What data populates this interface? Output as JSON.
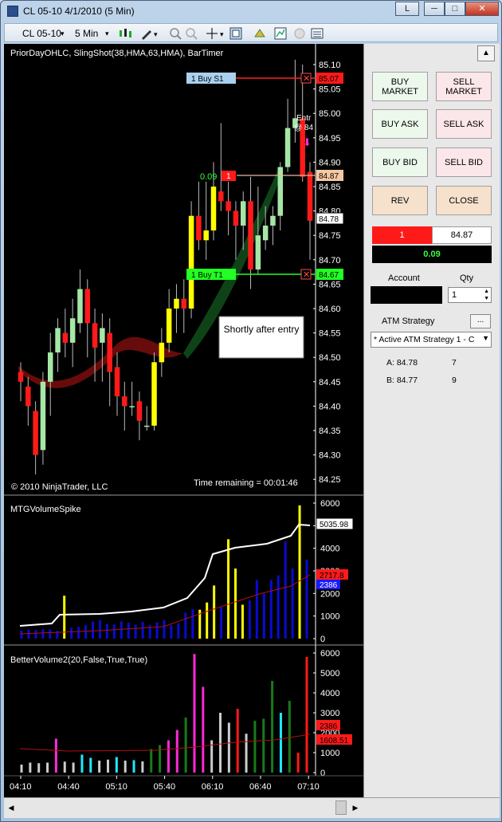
{
  "window": {
    "title": "CL 05-10  4/1/2010 (5 Min)",
    "link_btn": "L"
  },
  "toolbar": {
    "instrument": "CL 05-10",
    "interval": "5 Min"
  },
  "chart": {
    "indicator_label": "PriorDayOHLC, SlingShot(38,HMA,63,HMA), BarTimer",
    "copyright": "© 2010 NinjaTrader, LLC",
    "time_remaining": "Time remaining = 00:01:46",
    "annotation": "Shortly after entry",
    "entry_text": "Entr",
    "entry_text2": "@ 84",
    "orders": {
      "stop_label": "1  Buy S1",
      "stop_price": "85.07",
      "entry_qty": "1",
      "entry_pnl": "0.09",
      "entry_price": "84.87",
      "last_price": "84.78",
      "target_label": "1  Buy T1",
      "target_price": "84.67"
    },
    "price_ticks": [
      "85.10",
      "85.05",
      "85.00",
      "84.95",
      "84.90",
      "84.85",
      "84.80",
      "84.75",
      "84.70",
      "84.65",
      "84.60",
      "84.55",
      "84.50",
      "84.45",
      "84.40",
      "84.35",
      "84.30",
      "84.25"
    ],
    "vol_label": "MTGVolumeSpike",
    "vol_ticks": [
      "6000",
      "5000",
      "4000",
      "3000",
      "2000",
      "1000",
      "0"
    ],
    "vol_values": {
      "a": "5035.98",
      "b": "2717.8",
      "c": "2386"
    },
    "bv_label": "BetterVolume2(20,False,True,True)",
    "bv_ticks": [
      "6000",
      "5000",
      "4000",
      "3000",
      "2000",
      "1000",
      "0"
    ],
    "bv_values": {
      "a": "2386",
      "b": "1608.51"
    },
    "time_ticks": [
      "04:10",
      "04:40",
      "05:10",
      "05:40",
      "06:10",
      "06:40",
      "07:10"
    ]
  },
  "chart_data": {
    "type": "candlestick",
    "title": "CL 05-10 4/1/2010 (5 Min)",
    "x": [
      "04:10",
      "04:40",
      "05:10",
      "05:40",
      "06:10",
      "06:40",
      "07:10"
    ],
    "price_range": [
      84.25,
      85.12
    ],
    "candles": [
      [
        84.47,
        84.45,
        84.49,
        84.41
      ],
      [
        84.44,
        84.4,
        84.46,
        84.36
      ],
      [
        84.39,
        84.3,
        84.41,
        84.26
      ],
      [
        84.31,
        84.45,
        84.47,
        84.28
      ],
      [
        84.45,
        84.51,
        84.55,
        84.38
      ],
      [
        84.51,
        84.56,
        84.58,
        84.47
      ],
      [
        84.55,
        84.53,
        84.6,
        84.5
      ],
      [
        84.53,
        84.58,
        84.62,
        84.48
      ],
      [
        84.57,
        84.64,
        84.68,
        84.55
      ],
      [
        84.64,
        84.57,
        84.66,
        84.5
      ],
      [
        84.57,
        84.52,
        84.6,
        84.45
      ],
      [
        84.53,
        84.56,
        84.59,
        84.45
      ],
      [
        84.55,
        84.47,
        84.58,
        84.4
      ],
      [
        84.48,
        84.42,
        84.51,
        84.38
      ],
      [
        84.42,
        84.4,
        84.45,
        84.35
      ],
      [
        84.4,
        84.4,
        84.45,
        84.38
      ],
      [
        84.41,
        84.37,
        84.43,
        84.33
      ],
      [
        84.36,
        84.36,
        84.4,
        84.35
      ],
      [
        84.36,
        84.49,
        84.51,
        84.35
      ],
      [
        84.49,
        84.53,
        84.56,
        84.46
      ],
      [
        84.53,
        84.6,
        84.64,
        84.51
      ],
      [
        84.6,
        84.62,
        84.65,
        84.55
      ],
      [
        84.62,
        84.6,
        84.66,
        84.55
      ],
      [
        84.6,
        84.79,
        84.82,
        84.58
      ],
      [
        84.79,
        84.74,
        84.86,
        84.72
      ],
      [
        84.74,
        84.76,
        84.86,
        84.7
      ],
      [
        84.76,
        84.85,
        84.9,
        84.74
      ],
      [
        84.84,
        84.82,
        84.98,
        84.8
      ],
      [
        84.82,
        84.8,
        84.86,
        84.75
      ],
      [
        84.8,
        84.77,
        84.82,
        84.7
      ],
      [
        84.77,
        84.82,
        84.84,
        84.72
      ],
      [
        84.82,
        84.68,
        84.87,
        84.64
      ],
      [
        84.68,
        84.75,
        84.85,
        84.67
      ],
      [
        84.74,
        84.77,
        84.81,
        84.72
      ],
      [
        84.77,
        84.79,
        84.81,
        84.73
      ],
      [
        84.79,
        84.89,
        84.9,
        84.76
      ],
      [
        84.89,
        84.97,
        85.03,
        84.88
      ],
      [
        84.97,
        84.99,
        85.11,
        84.94
      ],
      [
        84.99,
        84.87,
        85.1,
        84.86
      ],
      [
        84.88,
        84.78,
        84.9,
        84.7
      ]
    ],
    "volume": {
      "series": [
        {
          "name": "MTGVolumeSpike",
          "values": [
            350,
            400,
            380,
            420,
            400,
            340,
            1900,
            480,
            520,
            600,
            750,
            820,
            640,
            620,
            760,
            700,
            620,
            740,
            600,
            720,
            820,
            600,
            680,
            1150,
            1300,
            1280,
            1600,
            2350,
            1400,
            4400,
            3100,
            1500,
            1680,
            2600,
            2000,
            2600,
            2800,
            4300,
            3100,
            5900,
            3500
          ]
        }
      ],
      "average_line": "5035.98",
      "ylim": [
        0,
        6000
      ]
    },
    "better_volume": {
      "values": [
        400,
        500,
        470,
        500,
        1700,
        550,
        500,
        900,
        740,
        600,
        650,
        780,
        600,
        620,
        560,
        1180,
        1380,
        1620,
        2140,
        2760,
        5950,
        4300,
        1620,
        3000,
        2500,
        3200,
        1950,
        2600,
        2700,
        4600,
        3000,
        3600,
        1000,
        5800
      ],
      "average": "1608.51",
      "ylim": [
        0,
        6000
      ]
    }
  },
  "panel": {
    "buy_market": "BUY MARKET",
    "sell_market": "SELL MARKET",
    "buy_ask": "BUY ASK",
    "sell_ask": "SELL ASK",
    "buy_bid": "BUY BID",
    "sell_bid": "SELL BID",
    "rev": "REV",
    "close": "CLOSE",
    "pos_qty": "1",
    "pos_price": "84.87",
    "pnl": "0.09",
    "account_label": "Account",
    "qty_label": "Qty",
    "qty_value": "1",
    "atm_label": "ATM Strategy",
    "atm_btn": "...",
    "atm_select": "* Active ATM Strategy 1 - C",
    "a_label": "A: 84.78",
    "a_qty": "7",
    "b_label": "B: 84.77",
    "b_qty": "9"
  },
  "colors": {
    "up": "#a6e6a6",
    "down": "#ff1a1a",
    "yellow": "#ffff00",
    "blue": "#0a0ad2",
    "magenta": "#ff2ad7",
    "cyan": "#22e8ff"
  }
}
